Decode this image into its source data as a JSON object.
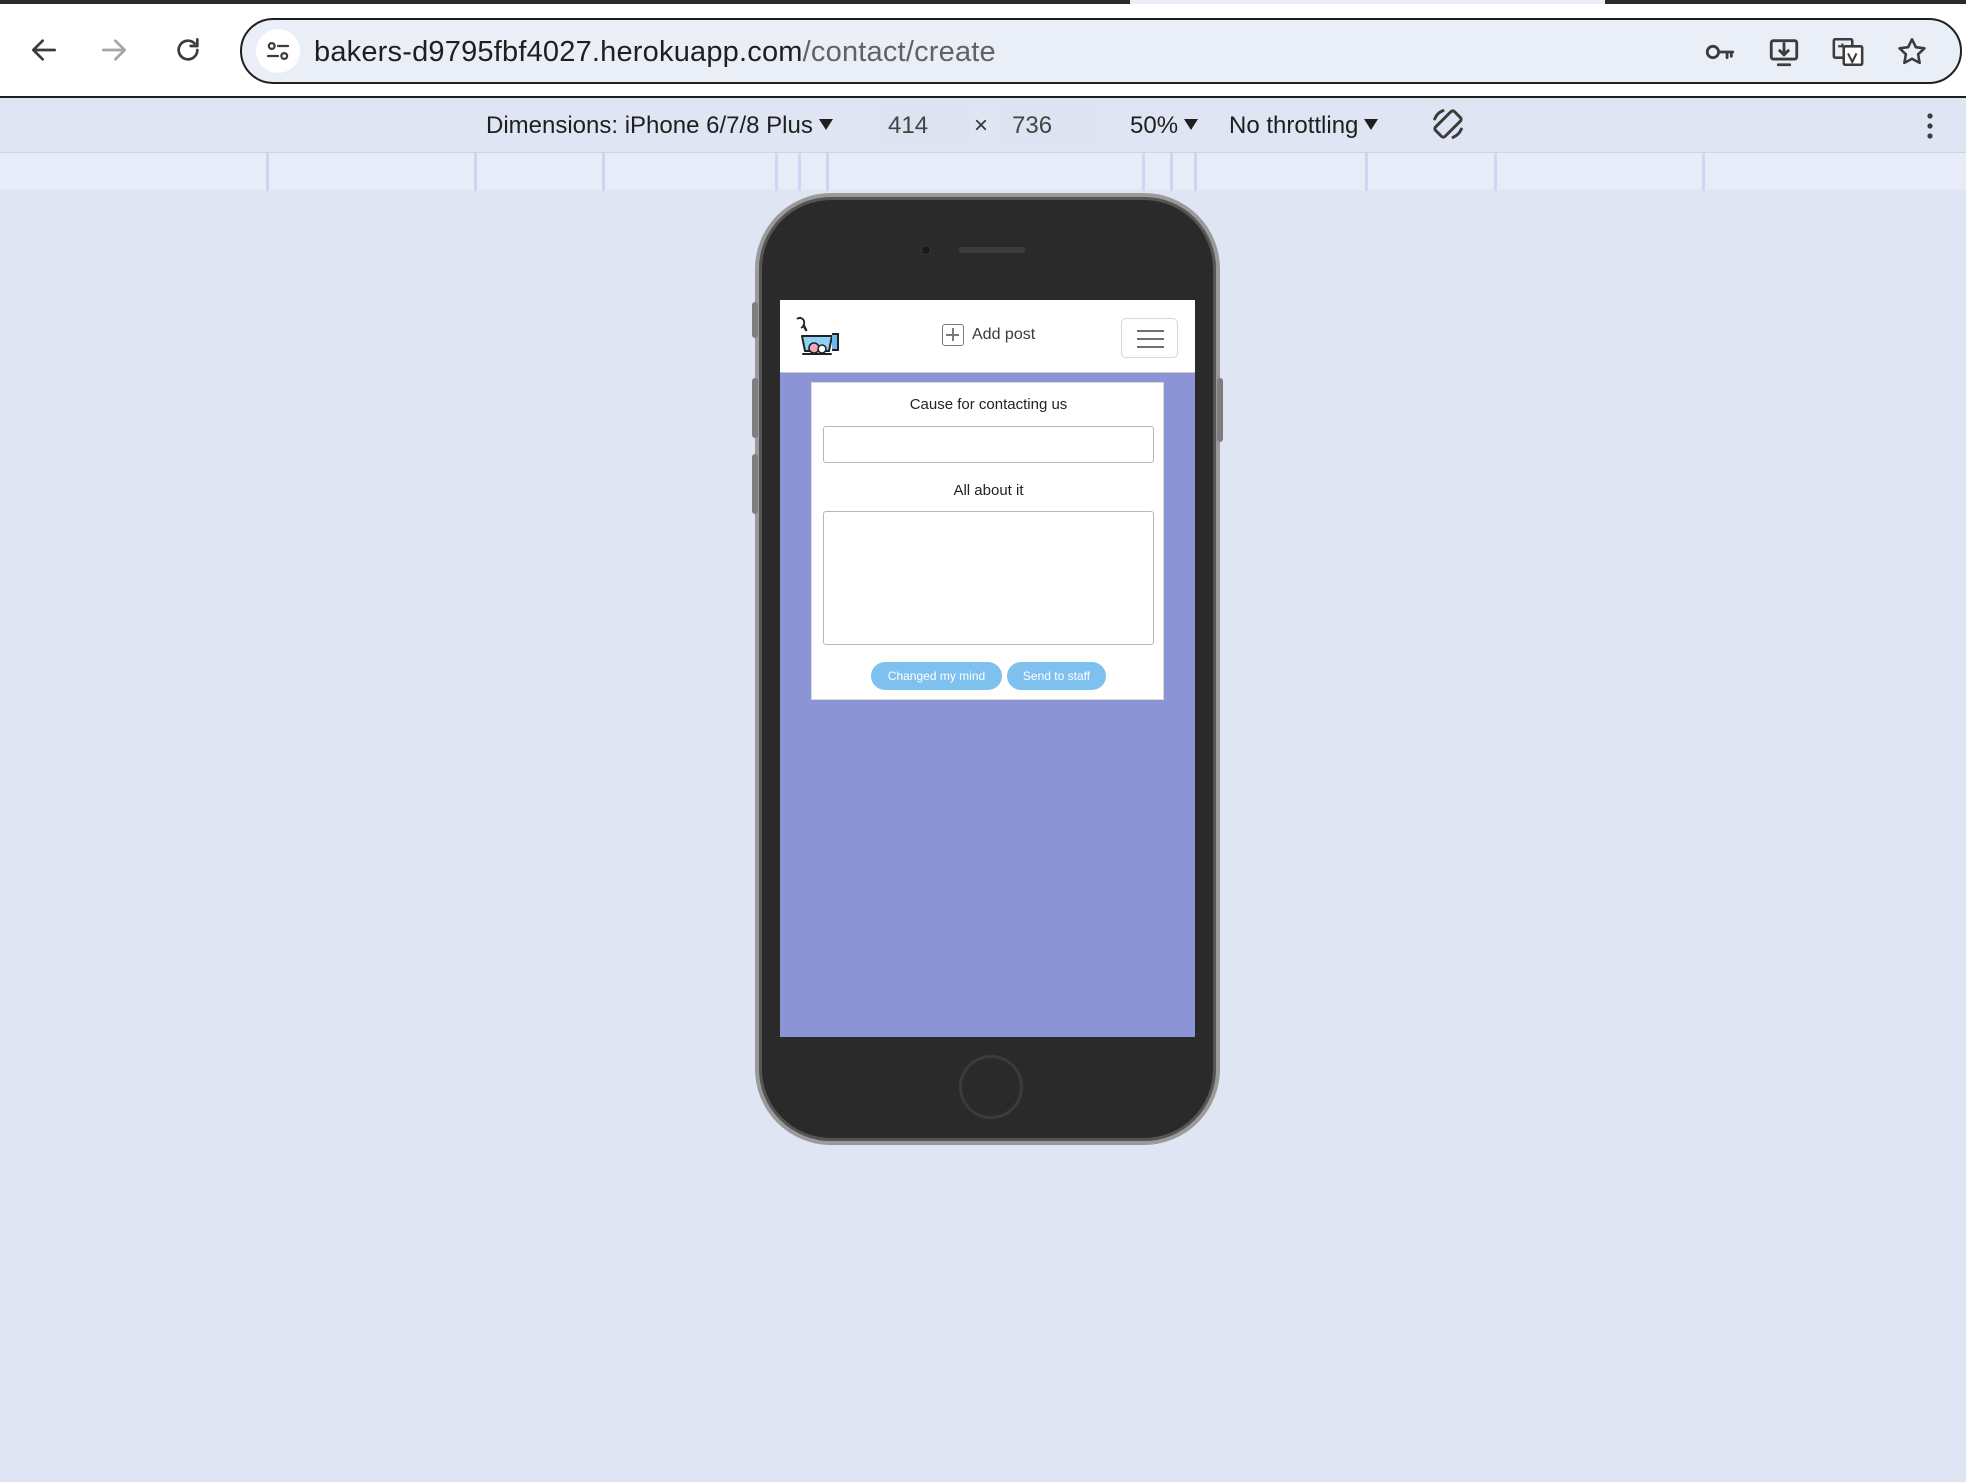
{
  "browser": {
    "url_host": "bakers-d9795fbf4027.herokuapp.com",
    "url_path": "/contact/create",
    "icons": [
      "back-arrow-icon",
      "forward-arrow-icon",
      "reload-icon",
      "site-settings-icon",
      "key-icon",
      "install-app-icon",
      "translate-icon",
      "bookmark-star-icon"
    ]
  },
  "device_toolbar": {
    "dimensions_label": "Dimensions: iPhone 6/7/8 Plus",
    "width_value": "414",
    "times_symbol": "×",
    "height_value": "736",
    "zoom": "50%",
    "throttling": "No throttling",
    "icons": [
      "rotate-icon",
      "more-options-icon"
    ]
  },
  "app": {
    "nav": {
      "add_post_label": "Add post",
      "icons": [
        "bakers-logo-icon",
        "plus-square-icon",
        "hamburger-menu-icon"
      ]
    },
    "contact_form": {
      "cause_label": "Cause for contacting us",
      "cause_value": "",
      "details_label": "All about it",
      "details_value": "",
      "cancel_button": "Changed my mind",
      "submit_button": "Send to staff"
    },
    "colors": {
      "page_background": "#8b95d6",
      "button": "#7fc1ee"
    }
  }
}
